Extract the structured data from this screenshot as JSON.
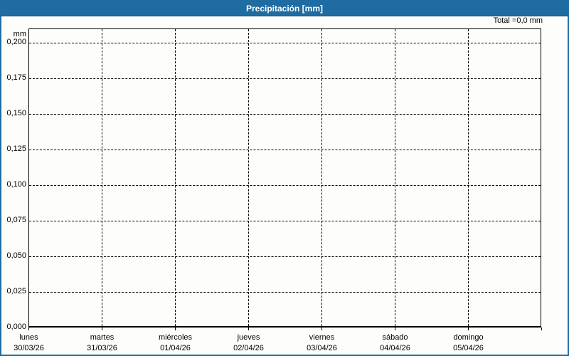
{
  "window": {
    "title": "Precipitación [mm]"
  },
  "header": {
    "total_label": "Total =0,0 mm"
  },
  "colors": {
    "titlebar": "#1e6ca1",
    "border": "#1e6ca1",
    "grid": "#000000",
    "title_text": "#ffffff",
    "background": "#fdfdfb"
  },
  "chart_data": {
    "type": "bar",
    "title": "Precipitación [mm]",
    "ylabel": "mm",
    "total_annotation": "Total =0,0 mm",
    "categories": [
      {
        "day": "lunes",
        "date": "30/03/26"
      },
      {
        "day": "martes",
        "date": "31/03/26"
      },
      {
        "day": "miércoles",
        "date": "01/04/26"
      },
      {
        "day": "jueves",
        "date": "02/04/26"
      },
      {
        "day": "viernes",
        "date": "03/04/26"
      },
      {
        "day": "sábado",
        "date": "04/04/26"
      },
      {
        "day": "domingo",
        "date": "05/04/26"
      }
    ],
    "values": [
      0,
      0,
      0,
      0,
      0,
      0,
      0
    ],
    "y_ticks": [
      {
        "label": "0,200",
        "value": 0.2
      },
      {
        "label": "0,175",
        "value": 0.175
      },
      {
        "label": "0,150",
        "value": 0.15
      },
      {
        "label": "0,125",
        "value": 0.125
      },
      {
        "label": "0,100",
        "value": 0.1
      },
      {
        "label": "0,075",
        "value": 0.075
      },
      {
        "label": "0,050",
        "value": 0.05
      },
      {
        "label": "0,025",
        "value": 0.025
      },
      {
        "label": "0,000",
        "value": 0.0
      }
    ],
    "ylim": [
      0,
      0.21
    ],
    "grid": true,
    "legend": false
  }
}
